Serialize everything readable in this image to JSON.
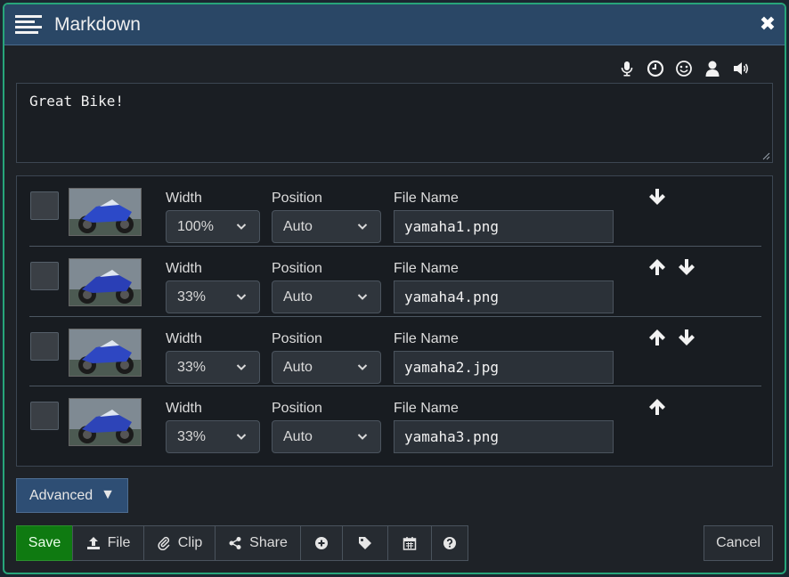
{
  "window": {
    "title": "Markdown",
    "close_icon": "close-icon"
  },
  "toolbar_icons": [
    "microphone-icon",
    "clock-icon",
    "smiley-icon",
    "user-icon",
    "speaker-icon"
  ],
  "editor": {
    "text": "Great Bike!"
  },
  "labels": {
    "width": "Width",
    "position": "Position",
    "file_name": "File Name"
  },
  "images": [
    {
      "width": "100%",
      "position": "Auto",
      "file_name": "yamaha1.png",
      "move_up": false,
      "move_down": true,
      "thumb_color": "#2c49c8"
    },
    {
      "width": "33%",
      "position": "Auto",
      "file_name": "yamaha4.png",
      "move_up": true,
      "move_down": true,
      "thumb_color": "#2a3fb6"
    },
    {
      "width": "33%",
      "position": "Auto",
      "file_name": "yamaha2.jpg",
      "move_up": true,
      "move_down": true,
      "thumb_color": "#2e47c2"
    },
    {
      "width": "33%",
      "position": "Auto",
      "file_name": "yamaha3.png",
      "move_up": true,
      "move_down": false,
      "thumb_color": "#2d44b8"
    }
  ],
  "advanced": {
    "label": "Advanced",
    "icon": "triangle-down-icon"
  },
  "buttons": {
    "save": "Save",
    "file": "File",
    "clip": "Clip",
    "share": "Share",
    "add_icon": "plus-circle-icon",
    "tag_icon": "tag-icon",
    "calendar_icon": "calendar-icon",
    "help_icon": "question-circle-icon",
    "cancel": "Cancel"
  },
  "colors": {
    "accent_border": "#27a57a",
    "titlebar": "#2a4766",
    "save": "#0f7a11",
    "advanced": "#2e4e74"
  }
}
